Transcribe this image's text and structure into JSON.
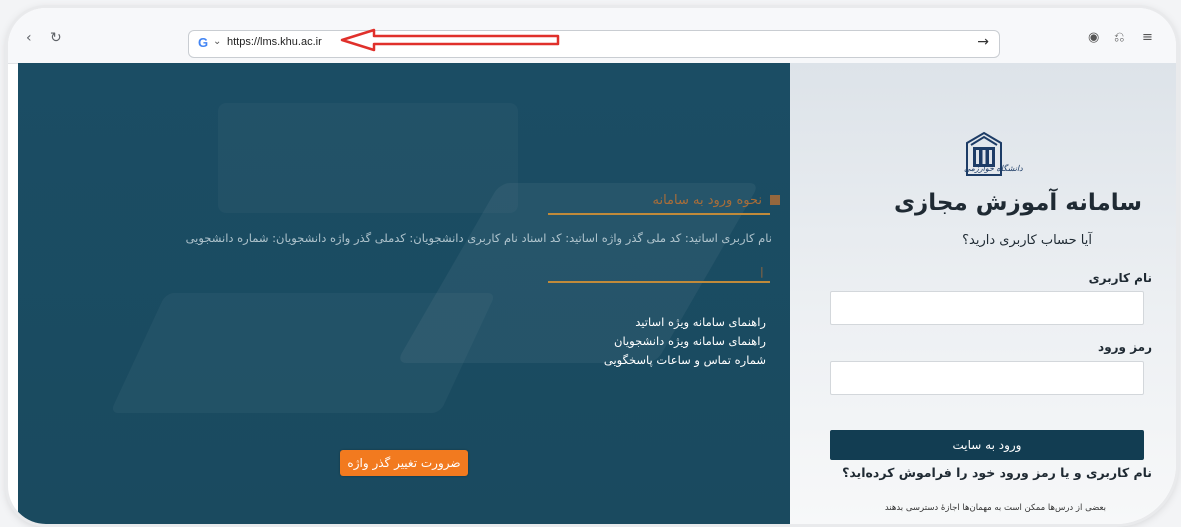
{
  "browser": {
    "url": "https://lms.khu.ac.ir",
    "search_engine_icon": "G",
    "dropdown_icon": "⌄",
    "go_icon": "→",
    "back_icon": "‹",
    "reload_icon": "↻",
    "profile_icon": "◉",
    "extensions_icon": "⎌",
    "menu_icon": "≡"
  },
  "left_panel": {
    "howto_title": "نحوه ورود به سامانه",
    "info_line": "نام کاربری اساتید: کد ملی گذر واژه اساتید: کد اسناد نام کاربری دانشجویان: کدملی گذر واژه دانشجویان: شماره دانشجویی",
    "links": [
      "راهنمای سامانه ویژه اساتید",
      "راهنمای سامانه ویژه دانشجویان",
      "شماره تماس و ساعات پاسخگویی"
    ],
    "change_password_button": "ضرورت تغییر گذر واژه",
    "accent_color": "#f27a1f"
  },
  "right_panel": {
    "logo_text": "دانشگاه خوارزمی",
    "title": "سامانه آموزش مجازی",
    "subtitle": "آیا حساب کاربری دارید؟",
    "username_label": "نام کاربری",
    "password_label": "رمز ورود",
    "login_button": "ورود به سایت",
    "forgot_link": "نام کاربری و یا رمز ورود خود را فراموش کرده‌اید؟",
    "guest_note": "بعضی از درس‌ها ممکن است به مهمان‌ها اجازهٔ دسترسی بدهند",
    "button_color": "#123d52"
  }
}
